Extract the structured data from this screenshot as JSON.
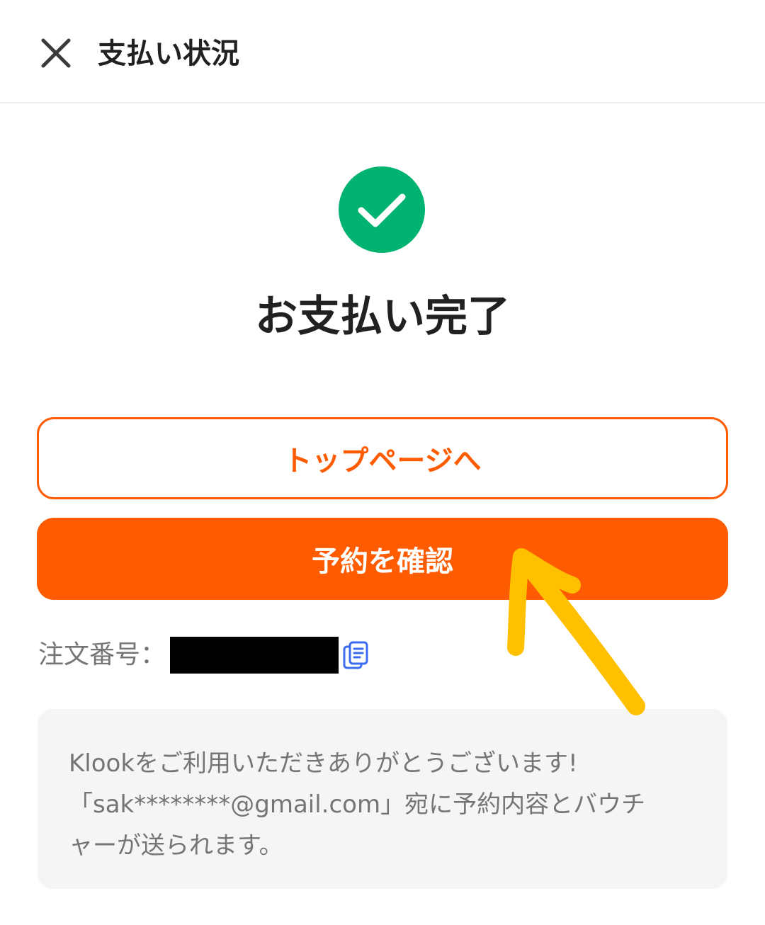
{
  "header": {
    "close_icon": "close-icon",
    "title": "支払い状況"
  },
  "status": {
    "icon": "check-circle-icon",
    "icon_color": "#00b371",
    "title": "お支払い完了"
  },
  "buttons": {
    "top_page_label": "トップページへ",
    "confirm_label": "予約を確認",
    "accent_color": "#ff5b00"
  },
  "order": {
    "label": "注文番号：",
    "number_redacted": true,
    "copy_icon": "copy-icon"
  },
  "info": {
    "message": "Klookをご利用いただきありがとうございます!\n「sak********@gmail.com」宛に予約内容とバウチ\nャーが送られます。"
  },
  "annotation": {
    "type": "hand-drawn arrow",
    "color": "#ffc000",
    "points_to": "confirm-reservation-button"
  }
}
